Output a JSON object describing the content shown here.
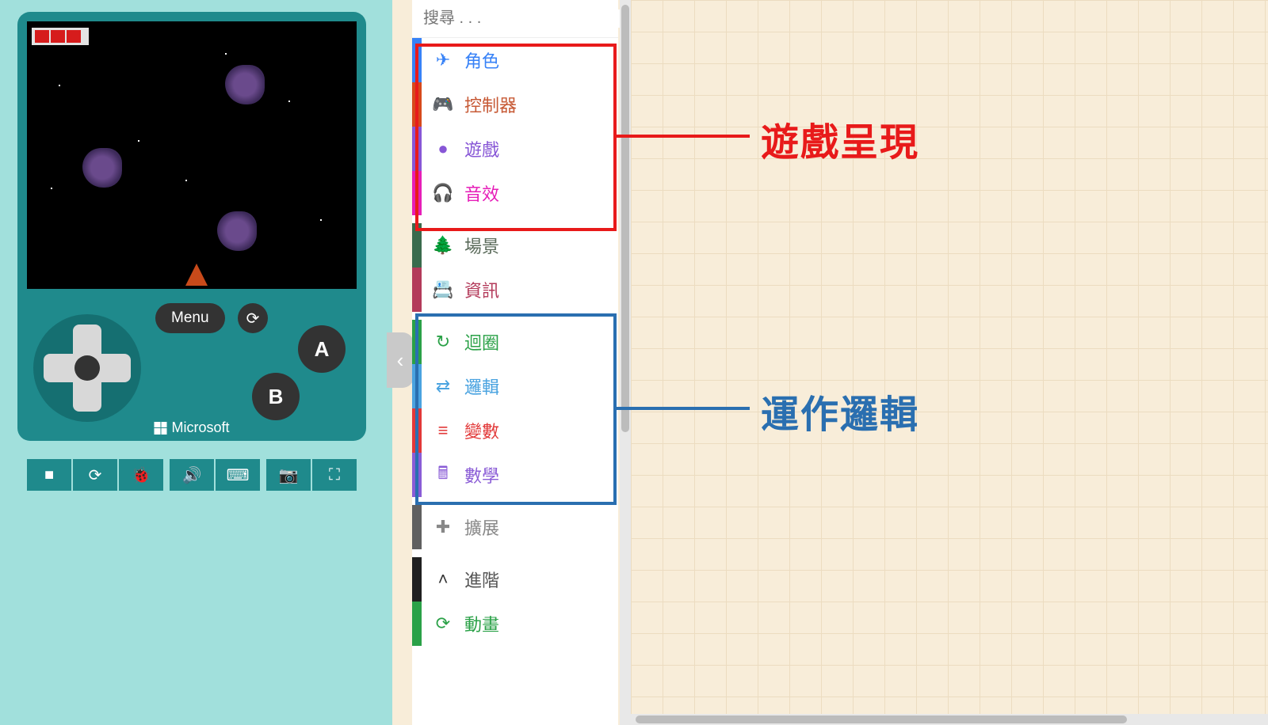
{
  "console": {
    "menu_label": "Menu",
    "a_label": "A",
    "b_label": "B",
    "brand": "Microsoft"
  },
  "toolbar": {
    "stop": "■",
    "reload": "⟳",
    "debug": "🐞",
    "sound": "🔊",
    "keyboard": "⌨",
    "camera": "📷",
    "fullscreen": "⛶"
  },
  "search": {
    "placeholder": "搜尋 . . ."
  },
  "categories": [
    {
      "bar": "#3782f7",
      "icon": "✈",
      "icon_color": "#3782f7",
      "label": "角色",
      "label_color": "#3782f7"
    },
    {
      "bar": "#d6491b",
      "icon": "🎮",
      "icon_color": "#d6491b",
      "label": "控制器",
      "label_color": "#c75a36"
    },
    {
      "bar": "#8756d6",
      "icon": "●",
      "icon_color": "#8756d6",
      "label": "遊戲",
      "label_color": "#8756d6"
    },
    {
      "bar": "#e61eb8",
      "icon": "🎧",
      "icon_color": "#e61eb8",
      "label": "音效",
      "label_color": "#e61eb8"
    },
    {
      "bar": "#3a6b4d",
      "icon": "🌲",
      "icon_color": "#4a7050",
      "label": "場景",
      "label_color": "#5a6a5a",
      "sep_before": true
    },
    {
      "bar": "#b33a5a",
      "icon": "📇",
      "icon_color": "#b33a5a",
      "label": "資訊",
      "label_color": "#b33a5a"
    },
    {
      "bar": "#2aa147",
      "icon": "↻",
      "icon_color": "#2aa147",
      "label": "迴圈",
      "label_color": "#2aa147",
      "sep_before": true
    },
    {
      "bar": "#4aa3e0",
      "icon": "⇄",
      "icon_color": "#4aa3e0",
      "label": "邏輯",
      "label_color": "#4aa3e0"
    },
    {
      "bar": "#e23838",
      "icon": "≡",
      "icon_color": "#e23838",
      "label": "變數",
      "label_color": "#e23838"
    },
    {
      "bar": "#8a5cd6",
      "icon": "🖩",
      "icon_color": "#8a5cd6",
      "label": "數學",
      "label_color": "#8a5cd6"
    },
    {
      "bar": "#606060",
      "icon": "✚",
      "icon_color": "#888888",
      "label": "擴展",
      "label_color": "#888888",
      "sep_before": true
    },
    {
      "bar": "#202020",
      "icon": "˄",
      "icon_color": "#333333",
      "label": "進階",
      "label_color": "#555555",
      "sep_before": true
    },
    {
      "bar": "#2aa147",
      "icon": "⟳",
      "icon_color": "#2aa147",
      "label": "動畫",
      "label_color": "#2aa147"
    }
  ],
  "annotations": {
    "red_label": "遊戲呈現",
    "blue_label": "運作邏輯"
  }
}
